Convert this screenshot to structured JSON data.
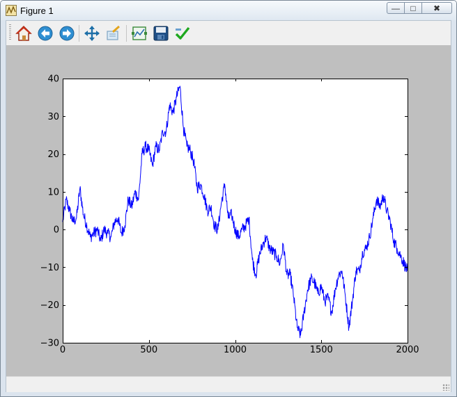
{
  "window": {
    "title": "Figure 1",
    "minimize_glyph": "—",
    "maximize_glyph": "□",
    "close_glyph": "✖"
  },
  "toolbar": {
    "buttons": [
      {
        "name": "home-button",
        "icon": "home-icon"
      },
      {
        "name": "back-button",
        "icon": "back-arrow-icon"
      },
      {
        "name": "forward-button",
        "icon": "forward-arrow-icon"
      },
      {
        "name": "pan-button",
        "icon": "move-icon"
      },
      {
        "name": "zoom-button",
        "icon": "zoom-rect-icon"
      },
      {
        "name": "subplots-button",
        "icon": "subplots-icon"
      },
      {
        "name": "save-button",
        "icon": "save-icon"
      },
      {
        "name": "edit-axis-button",
        "icon": "checkmark-icon"
      }
    ]
  },
  "colors": {
    "line": "#0000ff",
    "canvas_bg": "#bfbfbf",
    "axes_bg": "#ffffff"
  },
  "chart_data": {
    "type": "line",
    "title": "",
    "xlabel": "",
    "ylabel": "",
    "xlim": [
      0,
      2000
    ],
    "ylim": [
      -30,
      40
    ],
    "xticks": [
      "0",
      "500",
      "1000",
      "1500",
      "2000"
    ],
    "yticks": [
      "−30",
      "−20",
      "−10",
      "0",
      "10",
      "20",
      "30",
      "40"
    ],
    "xtick_values": [
      0,
      500,
      1000,
      1500,
      2000
    ],
    "ytick_values": [
      -30,
      -20,
      -10,
      0,
      10,
      20,
      30,
      40
    ],
    "grid": false,
    "legend": "none",
    "series": [
      {
        "x": [
          0,
          20,
          40,
          60,
          80,
          100,
          120,
          140,
          160,
          180,
          200,
          220,
          240,
          260,
          280,
          300,
          320,
          340,
          360,
          380,
          400,
          420,
          440,
          460,
          480,
          500,
          520,
          540,
          560,
          580,
          600,
          620,
          640,
          660,
          680,
          700,
          720,
          740,
          760,
          780,
          800,
          820,
          840,
          860,
          880,
          900,
          920,
          940,
          960,
          980,
          1000,
          1020,
          1040,
          1060,
          1080,
          1100,
          1120,
          1140,
          1160,
          1180,
          1200,
          1220,
          1240,
          1260,
          1280,
          1300,
          1320,
          1340,
          1360,
          1380,
          1400,
          1420,
          1440,
          1460,
          1480,
          1500,
          1520,
          1540,
          1560,
          1580,
          1600,
          1620,
          1640,
          1660,
          1680,
          1700,
          1720,
          1740,
          1760,
          1780,
          1800,
          1820,
          1840,
          1860,
          1880,
          1900,
          1920,
          1940,
          1960,
          1980,
          2000
        ],
        "y": [
          2,
          8,
          5,
          2,
          3,
          11,
          4,
          1,
          -2,
          -1,
          0,
          -3,
          0,
          -1,
          -2,
          2,
          3,
          -1,
          1,
          8,
          6,
          10,
          8,
          20,
          22,
          21,
          17,
          22,
          21,
          26,
          26,
          33,
          31,
          35,
          38,
          27,
          22,
          21,
          18,
          11,
          12,
          9,
          5,
          6,
          1,
          0,
          7,
          12,
          3,
          4,
          0,
          -2,
          0,
          1,
          3,
          -8,
          -12,
          -7,
          -4,
          -2,
          -5,
          -6,
          -7,
          -9,
          -4,
          -12,
          -12,
          -18,
          -26,
          -28,
          -22,
          -16,
          -13,
          -14,
          -17,
          -15,
          -19,
          -18,
          -22,
          -16,
          -12,
          -11,
          -18,
          -26,
          -19,
          -11,
          -11,
          -6,
          -5,
          -2,
          3,
          8,
          6,
          9,
          5,
          2,
          -3,
          -5,
          -7,
          -9,
          -11
        ]
      }
    ]
  }
}
